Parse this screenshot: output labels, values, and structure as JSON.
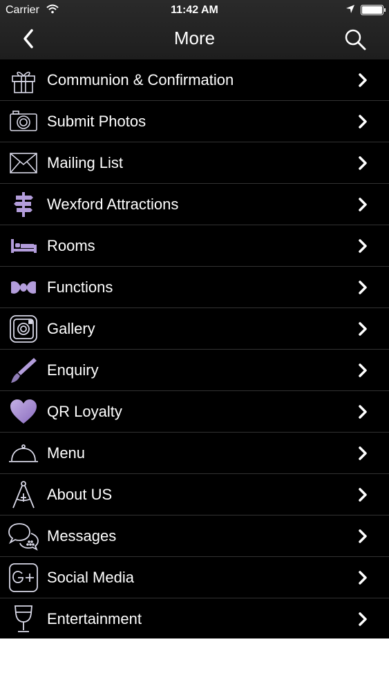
{
  "status_bar": {
    "carrier": "Carrier",
    "time": "11:42 AM"
  },
  "nav": {
    "title": "More"
  },
  "colors": {
    "accent": "#9b7fc7",
    "background": "#000000",
    "bar": "#242424"
  },
  "menu": {
    "items": [
      {
        "label": "Communion & Confirmation",
        "icon": "gift-icon"
      },
      {
        "label": "Submit Photos",
        "icon": "camera-icon"
      },
      {
        "label": "Mailing List",
        "icon": "envelope-icon"
      },
      {
        "label": "Wexford Attractions",
        "icon": "signpost-icon"
      },
      {
        "label": "Rooms",
        "icon": "bed-icon"
      },
      {
        "label": "Functions",
        "icon": "bowtie-icon"
      },
      {
        "label": "Gallery",
        "icon": "instagram-camera-icon"
      },
      {
        "label": "Enquiry",
        "icon": "brush-icon"
      },
      {
        "label": "QR Loyalty",
        "icon": "heart-icon"
      },
      {
        "label": "Menu",
        "icon": "cloche-icon"
      },
      {
        "label": "About US",
        "icon": "compass-icon"
      },
      {
        "label": "Messages",
        "icon": "chat-bubbles-icon"
      },
      {
        "label": "Social Media",
        "icon": "google-plus-icon"
      },
      {
        "label": "Entertainment",
        "icon": "wine-glass-icon"
      }
    ]
  }
}
